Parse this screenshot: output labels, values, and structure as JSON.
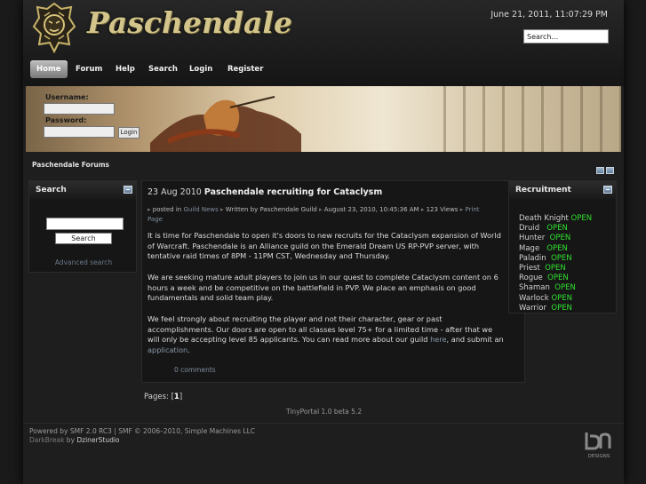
{
  "header": {
    "site_title": "Paschendale",
    "datetime": "June 21, 2011, 11:07:29 PM",
    "search_placeholder": "Search..."
  },
  "nav": {
    "items": [
      {
        "label": "Home",
        "active": true
      },
      {
        "label": "Forum"
      },
      {
        "label": "Help"
      },
      {
        "label": "Search"
      },
      {
        "label": "Login"
      },
      {
        "label": "Register"
      }
    ]
  },
  "login": {
    "username_label": "Username:",
    "password_label": "Password:",
    "button_label": "Login"
  },
  "breadcrumb": "Paschendale Forums",
  "search_panel": {
    "title": "Search",
    "button_label": "Search",
    "advanced_link": "Advanced search"
  },
  "article": {
    "date": "23 Aug 2010",
    "title": "Paschendale recruiting for Cataclysm",
    "meta": {
      "posted_in_prefix": "posted in",
      "category": "Guild News",
      "written_by": "Written by Paschendale Guild",
      "timestamp": "August 23, 2010, 10:45:36 AM",
      "views": "123 Views",
      "print": "Print Page"
    },
    "paragraph1": "It is time for Paschendale to open it's doors to new recruits for the Cataclysm expansion of World of Warcraft. Paschendale is an Alliance guild on the Emerald Dream US RP-PVP server, with tentative raid times of 8PM - 11PM CST, Wednesday and Thursday.",
    "paragraph2": "We are seeking mature adult players to join us in our quest to complete Cataclysm content on 6 hours a week and be competitive on the battlefield in PVP. We place an emphasis on good fundamentals and solid team play.",
    "paragraph3_text": "We feel strongly about recruiting the player and not their character, gear or past accomplishments. Our doors are open to all classes level 75+ for a limited time - after that we will only be accepting level 85 applicants. You can read more about our guild ",
    "paragraph3_link1": "here",
    "paragraph3_mid": ", and submit an ",
    "paragraph3_link2": "application",
    "paragraph3_end": ".",
    "comments": "0 comments"
  },
  "pages": {
    "label": "Pages: [",
    "current": "1",
    "end": "]"
  },
  "tinyportal": "TinyPortal 1.0 beta 5.2",
  "recruitment": {
    "title": "Recruitment",
    "classes": [
      {
        "name": "Death Knight",
        "status": "OPEN"
      },
      {
        "name": "Druid",
        "status": "OPEN"
      },
      {
        "name": "Hunter",
        "status": "OPEN"
      },
      {
        "name": "Mage",
        "status": "OPEN"
      },
      {
        "name": "Paladin",
        "status": "OPEN"
      },
      {
        "name": "Priest",
        "status": "OPEN"
      },
      {
        "name": "Rogue",
        "status": "OPEN"
      },
      {
        "name": "Shaman",
        "status": "OPEN"
      },
      {
        "name": "Warlock",
        "status": "OPEN"
      },
      {
        "name": "Warrior",
        "status": "OPEN"
      }
    ]
  },
  "footer": {
    "line1": "Powered by SMF 2.0 RC3 | SMF © 2006–2010, Simple Machines LLC",
    "line2_theme": "DarkBreak",
    "line2_by": " by ",
    "line2_author": "DzinerStudio",
    "logo_text": "DESIGNS"
  },
  "colors": {
    "open_status": "#2ee02e",
    "logo_gold": "#d2c48a",
    "link": "#8a9aaa"
  }
}
